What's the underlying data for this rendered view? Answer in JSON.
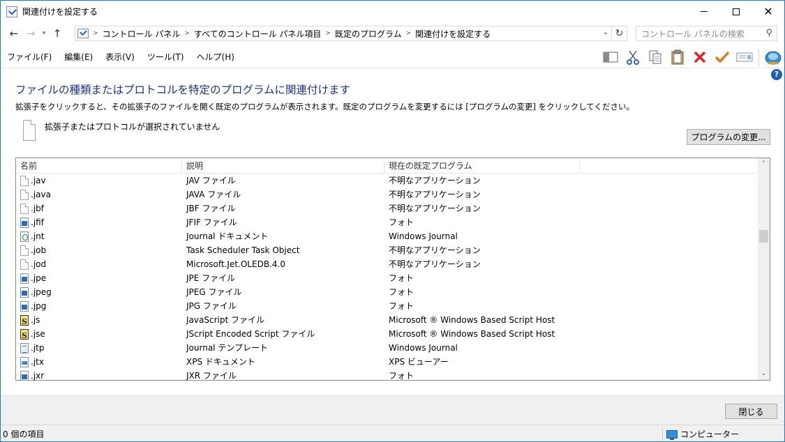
{
  "window": {
    "title": "関連付けを設定する",
    "close_glyph": "✕"
  },
  "address": {
    "breadcrumbs": [
      "コントロール パネル",
      "すべてのコントロール パネル項目",
      "既定のプログラム",
      "関連付けを設定する"
    ],
    "search_placeholder": "コントロール パネルの検索"
  },
  "menu": {
    "items": [
      "ファイル(F)",
      "編集(E)",
      "表示(V)",
      "ツール(T)",
      "ヘルプ(H)"
    ]
  },
  "toolbar": {
    "icons": [
      "panel-toggle-icon",
      "cut-icon",
      "copy-icon",
      "paste-icon",
      "delete-icon",
      "check-icon",
      "properties-icon",
      "shell-icon"
    ],
    "colors": {
      "delete": "#d9242b",
      "check": "#e5731c",
      "cut": "#2a6ab8"
    }
  },
  "main": {
    "heading": "ファイルの種類またはプロトコルを特定のプログラムに関連付けます",
    "description": "拡張子をクリックすると、その拡張子のファイルを開く既定のプログラムが表示されます。既定のプログラムを変更するには [プログラムの変更] をクリックしてください。",
    "selection_text": "拡張子またはプロトコルが選択されていません",
    "change_button": "プログラムの変更..."
  },
  "list": {
    "columns": {
      "name": "名前",
      "description": "説明",
      "program": "現在の既定プログラム"
    },
    "rows": [
      {
        "ext": ".jav",
        "desc": "JAV ファイル",
        "prog": "不明なアプリケーション",
        "icon": "blank"
      },
      {
        "ext": ".java",
        "desc": "JAVA ファイル",
        "prog": "不明なアプリケーション",
        "icon": "blank"
      },
      {
        "ext": ".jbf",
        "desc": "JBF ファイル",
        "prog": "不明なアプリケーション",
        "icon": "blank"
      },
      {
        "ext": ".jfif",
        "desc": "JFIF ファイル",
        "prog": "フォト",
        "icon": "photo"
      },
      {
        "ext": ".jnt",
        "desc": "Journal ドキュメント",
        "prog": "Windows Journal",
        "icon": "journal"
      },
      {
        "ext": ".job",
        "desc": "Task Scheduler Task Object",
        "prog": "不明なアプリケーション",
        "icon": "blank"
      },
      {
        "ext": ".jod",
        "desc": "Microsoft.Jet.OLEDB.4.0",
        "prog": "不明なアプリケーション",
        "icon": "blank"
      },
      {
        "ext": ".jpe",
        "desc": "JPE ファイル",
        "prog": "フォト",
        "icon": "photo"
      },
      {
        "ext": ".jpeg",
        "desc": "JPEG ファイル",
        "prog": "フォト",
        "icon": "photo"
      },
      {
        "ext": ".jpg",
        "desc": "JPG ファイル",
        "prog": "フォト",
        "icon": "photo"
      },
      {
        "ext": ".js",
        "desc": "JavaScript ファイル",
        "prog": "Microsoft ® Windows Based Script Host",
        "icon": "script"
      },
      {
        "ext": ".jse",
        "desc": "JScript Encoded Script ファイル",
        "prog": "Microsoft ® Windows Based Script Host",
        "icon": "script"
      },
      {
        "ext": ".jtp",
        "desc": "Journal テンプレート",
        "prog": "Windows Journal",
        "icon": "template"
      },
      {
        "ext": ".jtx",
        "desc": "XPS ドキュメント",
        "prog": "XPS ビューアー",
        "icon": "xps"
      },
      {
        "ext": ".jxr",
        "desc": "JXR ファイル",
        "prog": "フォト",
        "icon": "photo"
      }
    ]
  },
  "footer": {
    "close_button": "閉じる"
  },
  "status": {
    "items_count": "0 個の項目",
    "location": "コンピューター"
  }
}
